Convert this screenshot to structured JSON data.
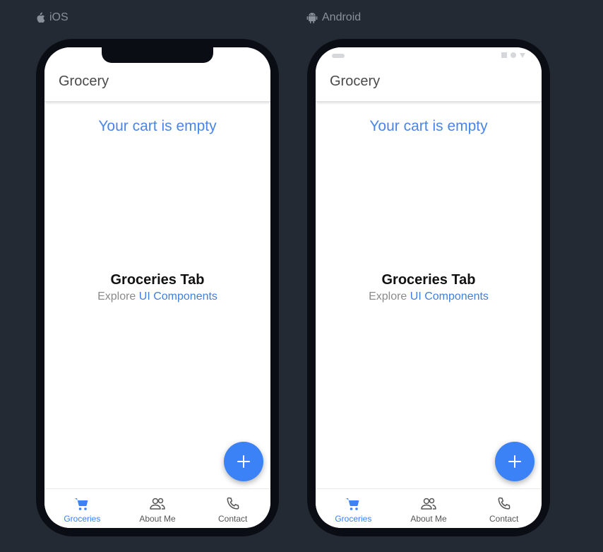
{
  "colors": {
    "background": "#242a33",
    "accent": "#3b82f6",
    "link": "#4a86e8"
  },
  "platforms": [
    {
      "label": "iOS",
      "icon": "apple-icon",
      "app_title": "Grocery",
      "cart_message": "Your cart is empty",
      "tab_heading": "Groceries Tab",
      "explore_prefix": "Explore",
      "explore_link": "UI Components",
      "fab_icon": "plus-icon",
      "tabs": [
        {
          "label": "Groceries",
          "icon": "cart-icon",
          "active": true
        },
        {
          "label": "About Me",
          "icon": "people-icon",
          "active": false
        },
        {
          "label": "Contact",
          "icon": "phone-icon",
          "active": false
        }
      ]
    },
    {
      "label": "Android",
      "icon": "android-icon",
      "app_title": "Grocery",
      "cart_message": "Your cart is empty",
      "tab_heading": "Groceries Tab",
      "explore_prefix": "Explore",
      "explore_link": "UI Components",
      "fab_icon": "plus-icon",
      "tabs": [
        {
          "label": "Groceries",
          "icon": "cart-icon",
          "active": true
        },
        {
          "label": "About Me",
          "icon": "people-icon",
          "active": false
        },
        {
          "label": "Contact",
          "icon": "phone-icon",
          "active": false
        }
      ]
    }
  ]
}
